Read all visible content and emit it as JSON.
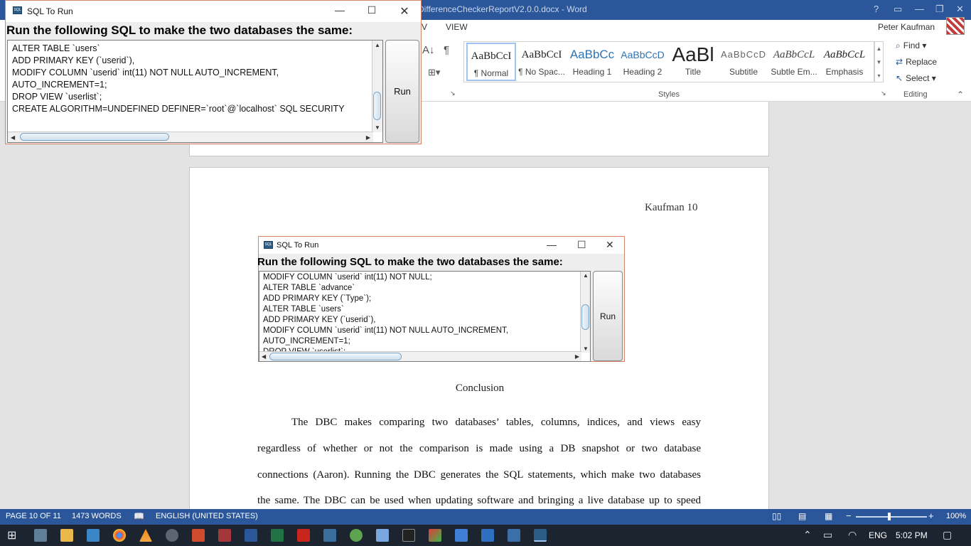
{
  "word": {
    "doc_title": "DifferenceCheckerReportV2.0.0.docx - Word",
    "tabs": [
      "V",
      "VIEW"
    ],
    "user_name": "Peter Kaufman",
    "styles": [
      {
        "sample": "AaBbCcI",
        "name": "¶ Normal",
        "selected": true
      },
      {
        "sample": "AaBbCcI",
        "name": "¶ No Spac..."
      },
      {
        "sample": "AaBbCc",
        "name": "Heading 1",
        "color": "#2e74b5"
      },
      {
        "sample": "AaBbCcD",
        "name": "Heading 2",
        "color": "#2e74b5"
      },
      {
        "sample": "AaBl",
        "name": "Title"
      },
      {
        "sample": "AaBbCcD",
        "name": "Subtitle"
      },
      {
        "sample": "AaBbCcL",
        "name": "Subtle Em..."
      },
      {
        "sample": "AaBbCcL",
        "name": "Emphasis"
      }
    ],
    "styles_label": "Styles",
    "editing": {
      "find": "Find",
      "replace": "Replace",
      "select": "Select",
      "label": "Editing"
    }
  },
  "document": {
    "header_text": "Kaufman 10",
    "conclusion_heading": "Conclusion",
    "paragraph_lines": [
      "The DBC makes comparing two databases’ tables, columns, indices, and views easy",
      "regardless of whether or not the comparison is made using a DB snapshot or two database",
      "connections (Aaron). Running the DBC generates the SQL statements, which make two databases",
      "the same. The DBC can be used when updating software and bringing a live database up to speed"
    ]
  },
  "sql_dialog_top": {
    "title": "SQL To Run",
    "heading": "Run the following SQL to make the two databases the same:",
    "lines": [
      "ALTER TABLE `users`",
      "ADD PRIMARY KEY (`userid`),",
      "MODIFY COLUMN `userid` int(11) NOT NULL AUTO_INCREMENT,",
      "AUTO_INCREMENT=1;",
      "DROP VIEW `userlist`;",
      "CREATE ALGORITHM=UNDEFINED DEFINER=`root`@`localhost` SQL SECURITY"
    ],
    "run_label": "Run"
  },
  "sql_dialog_embedded": {
    "title": "SQL To Run",
    "heading": "Run the following SQL to make the two databases the same:",
    "lines": [
      "MODIFY COLUMN `userid` int(11) NOT NULL;",
      "ALTER TABLE `advance`",
      "ADD PRIMARY KEY (`Type`);",
      "ALTER TABLE `users`",
      "ADD PRIMARY KEY (`userid`),",
      "MODIFY COLUMN `userid` int(11) NOT NULL AUTO_INCREMENT,",
      "AUTO_INCREMENT=1;",
      "DROP VIEW `userlist`;"
    ],
    "run_label": "Run"
  },
  "statusbar": {
    "page": "PAGE 10 OF 11",
    "words": "1473 WORDS",
    "language": "ENGLISH (UNITED STATES)",
    "zoom": "100%"
  },
  "taskbar": {
    "language": "ENG",
    "time": "5:02 PM"
  },
  "colors": {
    "word_blue": "#2b579a",
    "taskbar": "#1c2430",
    "dialog_border": "#d9826a"
  }
}
